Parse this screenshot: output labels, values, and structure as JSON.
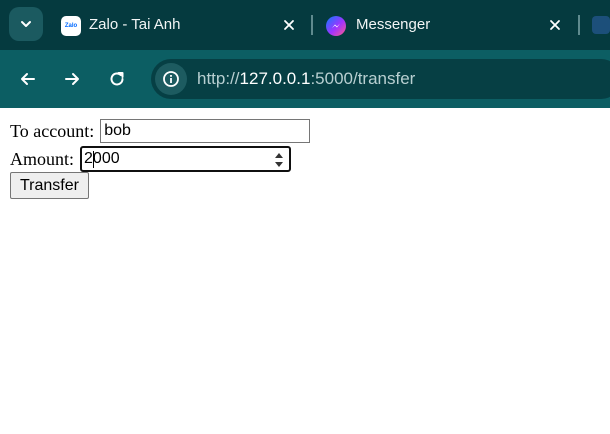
{
  "tabs": [
    {
      "title": "Zalo - Tai Anh",
      "icon": "zalo-icon",
      "icon_text": "Zalo",
      "active": false
    },
    {
      "title": "Messenger",
      "icon": "messenger-icon",
      "active": false
    }
  ],
  "toolbar": {
    "back_icon": "arrow-left-icon",
    "forward_icon": "arrow-right-icon",
    "reload_icon": "reload-icon"
  },
  "address_bar": {
    "scheme": "http://",
    "host": "127.0.0.1",
    "rest": ":5000/transfer",
    "site_info_icon": "info-icon"
  },
  "form": {
    "to_label": "To account:",
    "to_value": "bob",
    "amount_label": "Amount:",
    "amount_value": "2000",
    "submit_label": "Transfer"
  },
  "colors": {
    "tab_strip": "#053a3f",
    "toolbar": "#0c5e63",
    "omnibox": "#063f44"
  }
}
